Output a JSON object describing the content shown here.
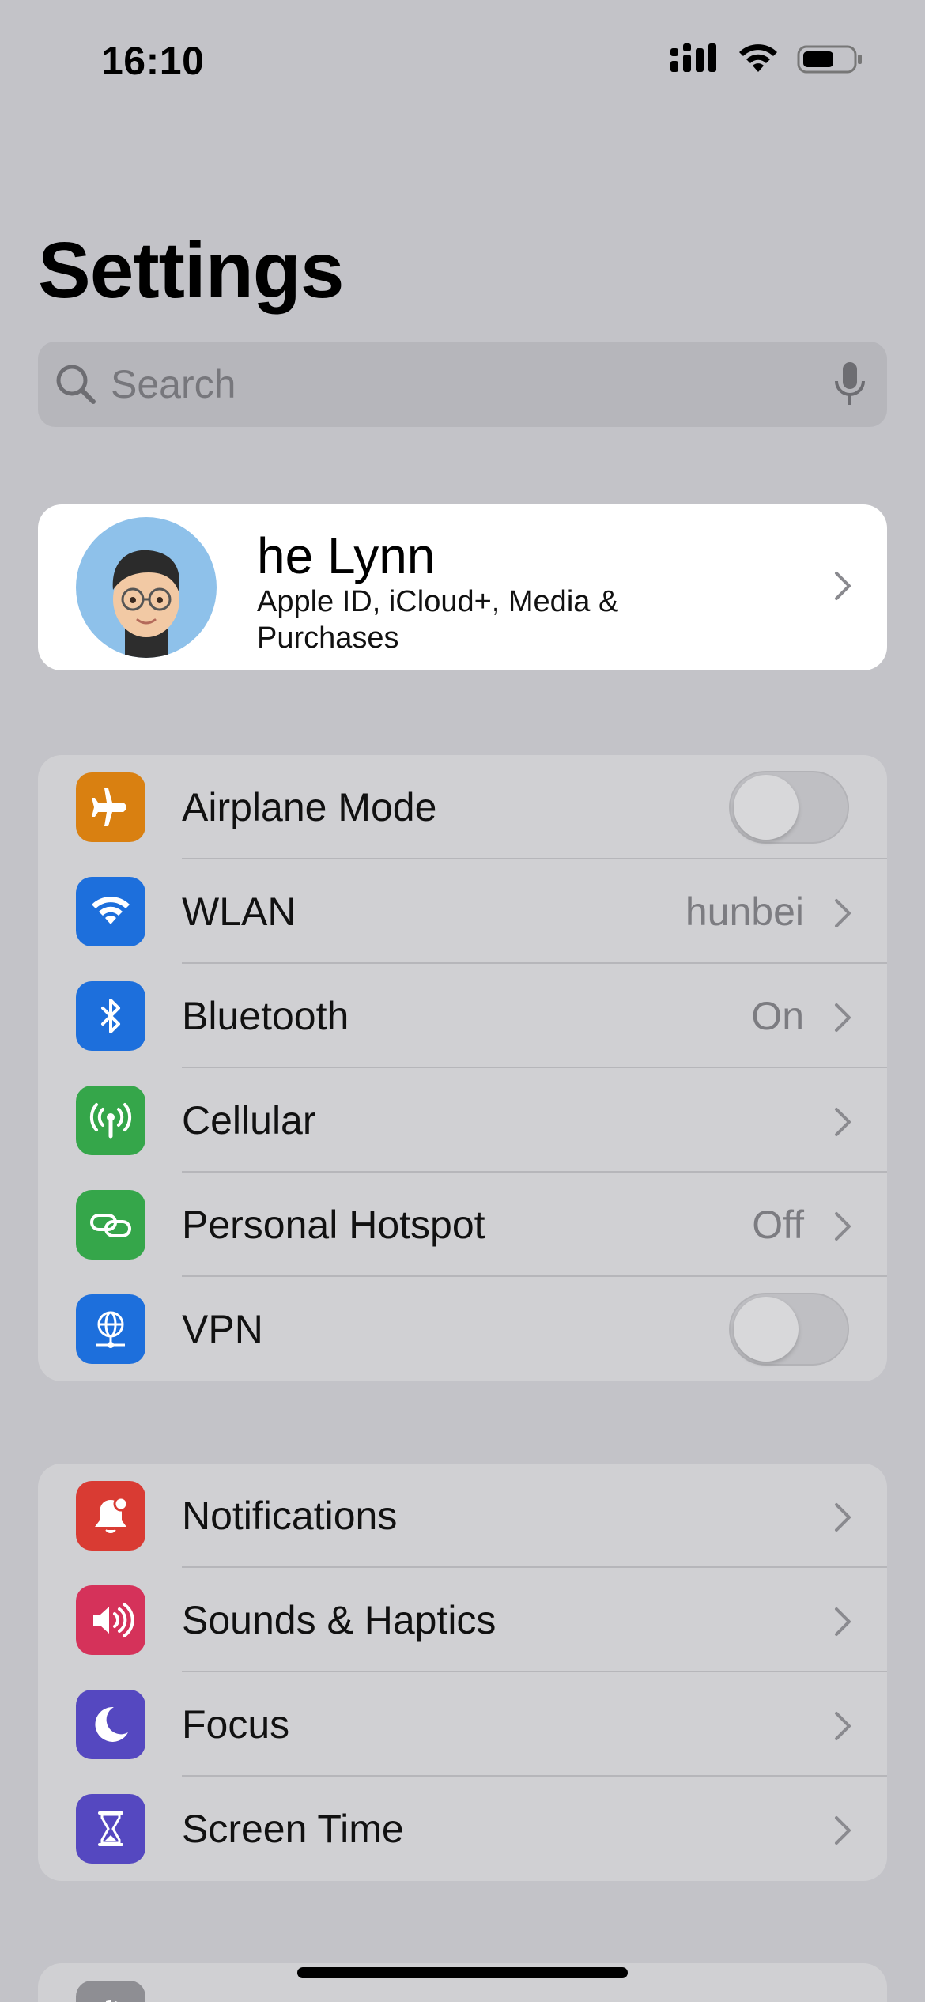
{
  "status_bar": {
    "time": "16:10"
  },
  "title": "Settings",
  "search": {
    "placeholder": "Search"
  },
  "profile": {
    "name": "he Lynn",
    "subtitle": "Apple ID, iCloud+, Media & Purchases"
  },
  "groups": [
    {
      "rows": [
        {
          "label": "Airplane Mode",
          "icon": "airplane-icon",
          "color": "#d98011",
          "control": "toggle",
          "on": false
        },
        {
          "label": "WLAN",
          "icon": "wifi-icon",
          "color": "#1d6fdc",
          "value": "hunbei"
        },
        {
          "label": "Bluetooth",
          "icon": "bluetooth-icon",
          "color": "#1d6fdc",
          "value": "On"
        },
        {
          "label": "Cellular",
          "icon": "antenna-icon",
          "color": "#35a64a"
        },
        {
          "label": "Personal Hotspot",
          "icon": "hotspot-link-icon",
          "color": "#35a64a",
          "value": "Off"
        },
        {
          "label": "VPN",
          "icon": "vpn-globe-icon",
          "color": "#1d6fdc",
          "control": "toggle",
          "on": false
        }
      ]
    },
    {
      "rows": [
        {
          "label": "Notifications",
          "icon": "bell-icon",
          "color": "#d93b33"
        },
        {
          "label": "Sounds & Haptics",
          "icon": "speaker-icon",
          "color": "#d5325a"
        },
        {
          "label": "Focus",
          "icon": "moon-icon",
          "color": "#5548c0"
        },
        {
          "label": "Screen Time",
          "icon": "hourglass-icon",
          "color": "#5548c0"
        }
      ]
    }
  ],
  "next_group_first_icon": {
    "icon": "gear-icon",
    "color": "#8e8e93"
  }
}
